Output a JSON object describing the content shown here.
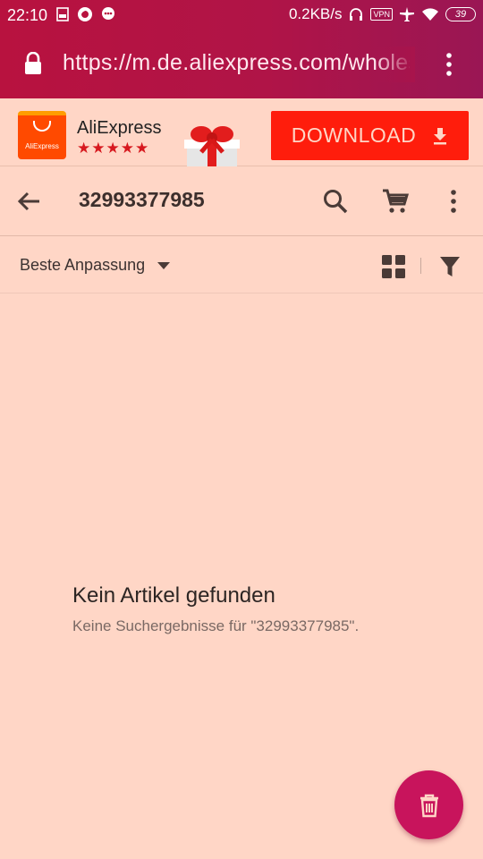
{
  "status_bar": {
    "time": "22:10",
    "network_speed": "0.2KB/s",
    "vpn": "VPN",
    "battery": "39",
    "icons": [
      "document-icon",
      "firefox-icon",
      "message-icon",
      "headphones-icon",
      "airplane-icon",
      "wifi-icon"
    ]
  },
  "browser": {
    "url": "https://m.de.aliexpress.com/wholesale"
  },
  "app_banner": {
    "app_name": "AliExpress",
    "logo_text": "AliExpress",
    "rating_stars": "★★★★★",
    "rating": 4.5,
    "download_label": "DOWNLOAD"
  },
  "header": {
    "query": "32993377985"
  },
  "sort_bar": {
    "sort_label": "Beste Anpassung"
  },
  "empty_state": {
    "title": "Kein Artikel gefunden",
    "subtitle": "Keine Suchergebnisse für \"32993377985\"."
  },
  "colors": {
    "chrome": "#b8123f",
    "background": "#ffd6c6",
    "download": "#ff1d0c",
    "fab": "#c8145c",
    "stars": "#d7191f"
  }
}
